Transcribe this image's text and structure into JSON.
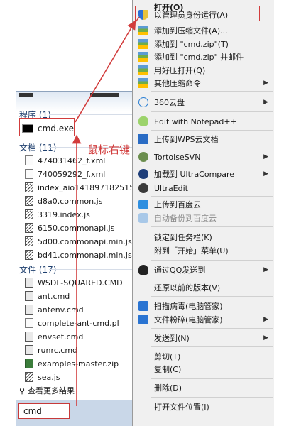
{
  "annotation": {
    "label": "鼠标右键"
  },
  "start_panel": {
    "sections": [
      {
        "title": "程序 (1)"
      },
      {
        "title": "文档 (11)"
      },
      {
        "title": "文件 (17)"
      }
    ],
    "program_items": [
      "cmd.exe"
    ],
    "document_items": [
      "474031462_f.xml",
      "740059292_f.xml",
      "index_aio1418971825158.js",
      "d8a0.common.js",
      "3319.index.js",
      "6150.commonapi.js",
      "5d00.commonapi.min.js",
      "bd41.commonapi.min.js"
    ],
    "file_items": [
      "WSDL-SQUARED.CMD",
      "ant.cmd",
      "antenv.cmd",
      "complete-ant-cmd.pl",
      "envset.cmd",
      "runrc.cmd",
      "examples-master.zip",
      "sea.js"
    ],
    "see_more": "查看更多结果",
    "search_value": "cmd"
  },
  "context_menu": {
    "items": [
      {
        "label": "打开(O)",
        "icon": "none-icon",
        "bold": true
      },
      {
        "label": "以管理员身份运行(A)",
        "icon": "shield-icon"
      },
      {
        "label": "添加到压缩文件(A)...",
        "icon": "archive-icon"
      },
      {
        "label": "添加到 \"cmd.zip\"(T)",
        "icon": "archive-icon"
      },
      {
        "label": "添加到 \"cmd.zip\" 并邮件",
        "icon": "archive-icon"
      },
      {
        "label": "用好压打开(Q)",
        "icon": "archive-icon"
      },
      {
        "label": "其他压缩命令",
        "icon": "archive-icon",
        "submenu": true
      },
      {
        "label": "360云盘",
        "icon": "cloud-icon",
        "submenu": true
      },
      {
        "label": "Edit with Notepad++",
        "icon": "notepad-icon"
      },
      {
        "label": "上传到WPS云文档",
        "icon": "wps-icon"
      },
      {
        "label": "TortoiseSVN",
        "icon": "svn-icon",
        "submenu": true
      },
      {
        "label": "加载到 UltraCompare",
        "icon": "compare-icon",
        "submenu": true
      },
      {
        "label": "UltraEdit",
        "icon": "ultraedit-icon"
      },
      {
        "label": "上传到百度云",
        "icon": "baidu-cloud-icon"
      },
      {
        "label": "自动备份到百度云",
        "icon": "baidu-cloud-icon",
        "disabled": true
      },
      {
        "label": "锁定到任务栏(K)",
        "icon": "none-icon"
      },
      {
        "label": "附到「开始」菜单(U)",
        "icon": "none-icon"
      },
      {
        "label": "通过QQ发送到",
        "icon": "qq-icon",
        "submenu": true
      },
      {
        "label": "还原以前的版本(V)",
        "icon": "none-icon"
      },
      {
        "label": "扫描病毒(电脑管家)",
        "icon": "scan-icon"
      },
      {
        "label": "文件粉碎(电脑管家)",
        "icon": "shred-icon",
        "submenu": true
      },
      {
        "label": "发送到(N)",
        "icon": "none-icon",
        "submenu": true
      },
      {
        "label": "剪切(T)",
        "icon": "none-icon"
      },
      {
        "label": "复制(C)",
        "icon": "none-icon"
      },
      {
        "label": "删除(D)",
        "icon": "none-icon"
      },
      {
        "label": "打开文件位置(I)",
        "icon": "none-icon"
      }
    ]
  },
  "colors": {
    "highlight": "#d23c3c",
    "menu_bg": "#f0f0f0",
    "section": "#1e3f6e"
  }
}
